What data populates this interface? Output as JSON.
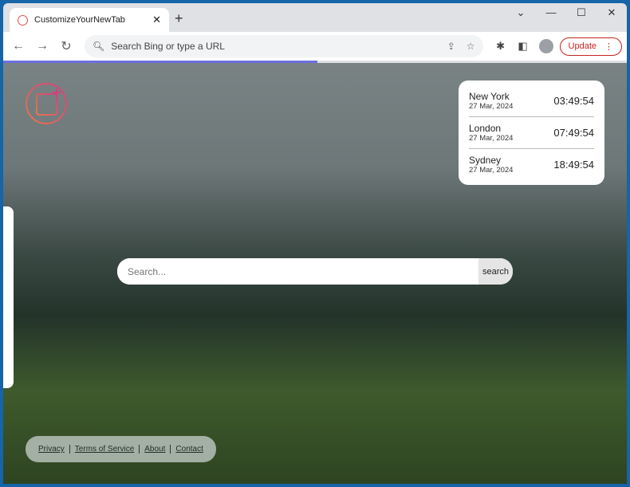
{
  "browser": {
    "tab_title": "CustomizeYourNewTab",
    "new_tab": "+",
    "omnibox_placeholder": "Search Bing or type a URL",
    "update_label": "Update"
  },
  "clocks": [
    {
      "city": "New York",
      "date": "27 Mar, 2024",
      "time": "03:49:54"
    },
    {
      "city": "London",
      "date": "27 Mar, 2024",
      "time": "07:49:54"
    },
    {
      "city": "Sydney",
      "date": "27 Mar, 2024",
      "time": "18:49:54"
    }
  ],
  "search": {
    "placeholder": "Search...",
    "button": "search"
  },
  "footer": {
    "links": [
      "Privacy",
      "Terms of Service",
      "About",
      "Contact"
    ]
  }
}
